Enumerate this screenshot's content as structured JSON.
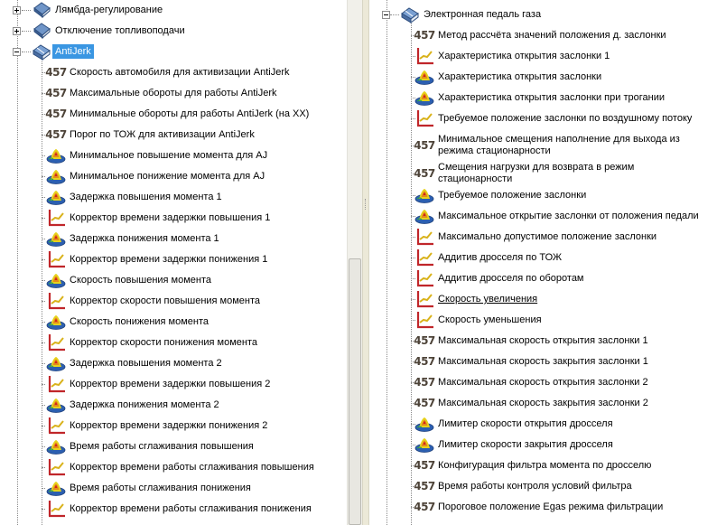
{
  "left": {
    "groups": [
      {
        "label": "Лямбда-регулирование",
        "icon": "book-icon",
        "expander": "plus"
      },
      {
        "label": "Отключение топливоподачи",
        "icon": "book-icon",
        "expander": "plus"
      },
      {
        "label": "AntiJerk",
        "icon": "book-open-icon",
        "expander": "minus",
        "selected": true
      }
    ],
    "items": [
      {
        "label": "Скорость автомобиля для активизации AntiJerk",
        "icon": "constant-457-icon"
      },
      {
        "label": "Максимальные обороты для работы AntiJerk",
        "icon": "constant-457-icon"
      },
      {
        "label": "Минимальные обороты для работы AntiJerk (на ХХ)",
        "icon": "constant-457-icon"
      },
      {
        "label": "Порог по ТОЖ для активизации AntiJerk",
        "icon": "constant-457-icon"
      },
      {
        "label": "Минимальное повышение момента для AJ",
        "icon": "3d-map-icon"
      },
      {
        "label": "Минимальное понижение момента для AJ",
        "icon": "3d-map-icon"
      },
      {
        "label": "Задержка повышения момента 1",
        "icon": "3d-map-icon"
      },
      {
        "label": "Корректор времени задержки повышения 1",
        "icon": "curve-chart-icon"
      },
      {
        "label": "Задержка понижения момента 1",
        "icon": "3d-map-icon"
      },
      {
        "label": "Корректор времени задержки понижения 1",
        "icon": "curve-chart-icon"
      },
      {
        "label": "Скорость повышения момента",
        "icon": "3d-map-icon"
      },
      {
        "label": "Корректор скорости повышения момента",
        "icon": "curve-chart-icon"
      },
      {
        "label": "Скорость понижения момента",
        "icon": "3d-map-icon"
      },
      {
        "label": "Корректор скорости понижения момента",
        "icon": "curve-chart-icon"
      },
      {
        "label": "Задержка повышения момента 2",
        "icon": "3d-map-icon"
      },
      {
        "label": "Корректор времени задержки повышения 2",
        "icon": "curve-chart-icon"
      },
      {
        "label": "Задержка понижения момента 2",
        "icon": "3d-map-icon"
      },
      {
        "label": "Корректор времени задержки понижения 2",
        "icon": "curve-chart-icon"
      },
      {
        "label": "Время работы сглаживания повышения",
        "icon": "3d-map-icon"
      },
      {
        "label": "Корректор времени работы сглаживания повышения",
        "icon": "curve-chart-icon"
      },
      {
        "label": "Время работы сглаживания понижения",
        "icon": "3d-map-icon"
      },
      {
        "label": "Корректор времени работы сглаживания понижения",
        "icon": "curve-chart-icon"
      }
    ]
  },
  "right": {
    "group": {
      "label": "Электронная педаль газа",
      "icon": "book-open-icon",
      "expander": "minus"
    },
    "items": [
      {
        "label": "Метод рассчёта значений положения д. заслонки",
        "icon": "constant-457-icon"
      },
      {
        "label": "Характеристика открытия заслонки 1",
        "icon": "curve-chart-icon"
      },
      {
        "label": "Характеристика открытия заслонки",
        "icon": "3d-map-icon"
      },
      {
        "label": "Характеристика открытия заслонки при трогании",
        "icon": "3d-map-icon"
      },
      {
        "label": "Требуемое положение заслонки по воздушному потоку",
        "icon": "curve-chart-icon"
      },
      {
        "label": "Минимальное смещения наполнение для выхода из",
        "label2": "режима стационарности",
        "icon": "constant-457-icon"
      },
      {
        "label": "Смещения нагрузки для возврата в режим",
        "label2": "стационарности",
        "icon": "constant-457-icon"
      },
      {
        "label": "Требуемое положение заслонки",
        "icon": "3d-map-icon"
      },
      {
        "label": "Максимальное открытие заслонки от положения педали",
        "icon": "3d-map-icon"
      },
      {
        "label": "Максимально допустимое положение заслонки",
        "icon": "curve-chart-icon"
      },
      {
        "label": "Аддитив дросселя по ТОЖ",
        "icon": "curve-chart-icon"
      },
      {
        "label": "Аддитив дросселя по оборотам",
        "icon": "curve-chart-icon"
      },
      {
        "label": "Скорость увеличения",
        "icon": "curve-chart-icon",
        "link": true
      },
      {
        "label": "Скорость уменьшения",
        "icon": "curve-chart-icon"
      },
      {
        "label": "Максимальная скорость открытия заслонки 1",
        "icon": "constant-457-icon"
      },
      {
        "label": "Максимальная скорость закрытия заслонки 1",
        "icon": "constant-457-icon"
      },
      {
        "label": "Максимальная скорость открытия заслонки 2",
        "icon": "constant-457-icon"
      },
      {
        "label": "Максимальная скорость закрытия заслонки 2",
        "icon": "constant-457-icon"
      },
      {
        "label": "Лимитер скорости открытия дросселя",
        "icon": "3d-map-icon"
      },
      {
        "label": "Лимитер скорости закрытия дросселя",
        "icon": "3d-map-icon"
      },
      {
        "label": "Конфигурация фильтра момента по дросселю",
        "icon": "constant-457-icon"
      },
      {
        "label": "Время работы контроля условий фильтра",
        "icon": "constant-457-icon"
      },
      {
        "label": "Пороговое положение Egas режима фильтрации",
        "icon": "constant-457-icon"
      }
    ]
  },
  "icon_text": "457",
  "colors": {
    "selection": "#3a96e2",
    "book": "#5b7fb3"
  }
}
